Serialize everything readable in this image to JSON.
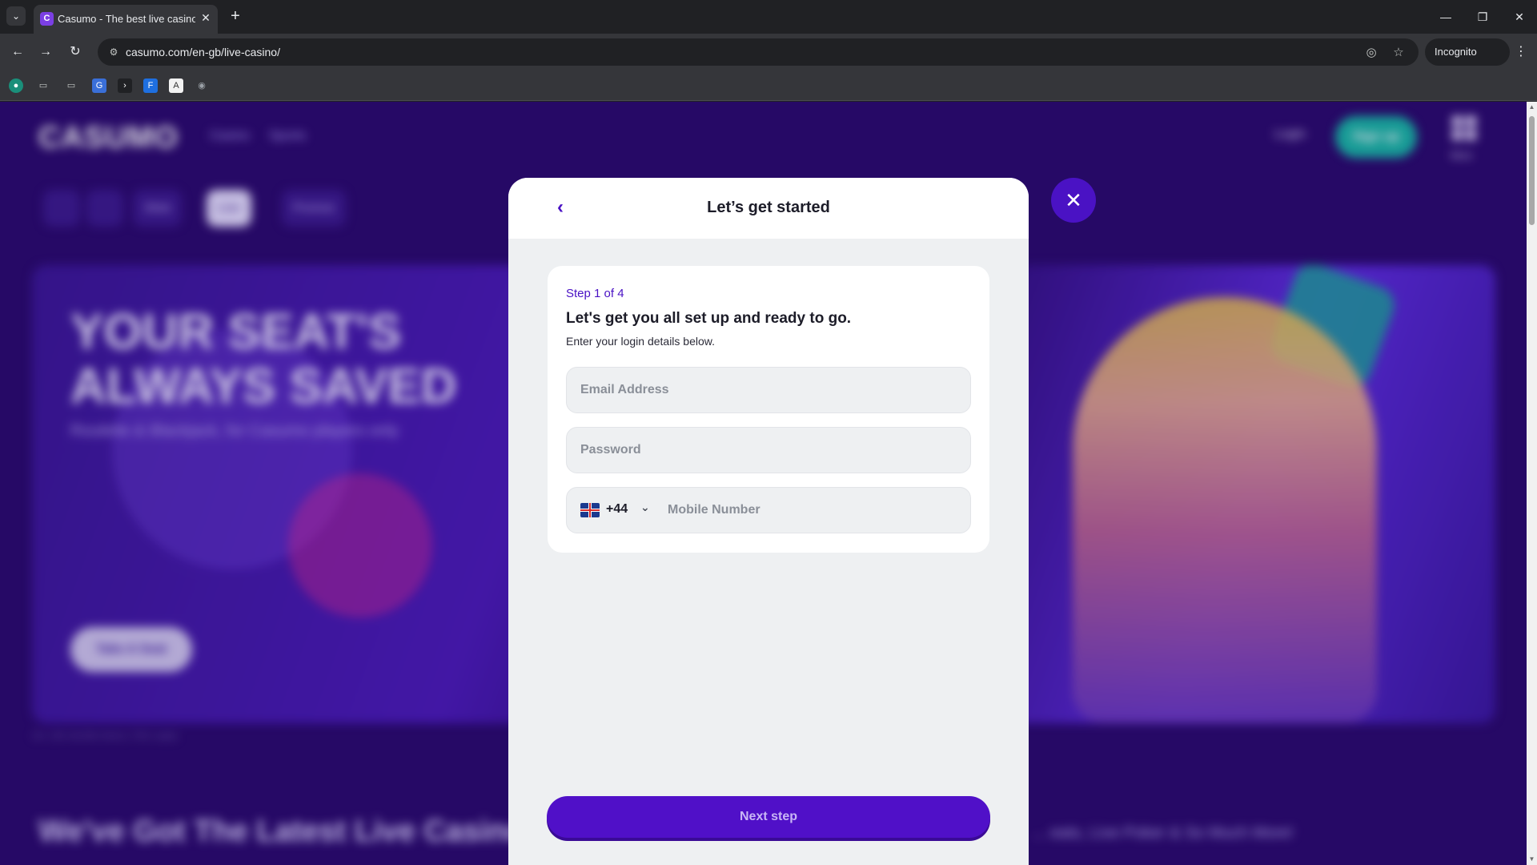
{
  "browser": {
    "tab": {
      "title": "Casumo - The best live casino in",
      "favicon_letter": "C"
    },
    "url": "casumo.com/en-gb/live-casino/",
    "incognito_label": "Incognito",
    "icons": {
      "back": "←",
      "forward": "→",
      "reload": "↻",
      "site_info": "⚙",
      "eye_off": "◎",
      "star": "☆",
      "menu": "⋮",
      "tab_list": "⌄",
      "new_tab": "+",
      "tab_close": "✕",
      "minimize": "—",
      "restore": "❐",
      "close": "✕"
    },
    "bookmarks": [
      "●",
      "▭",
      "▭",
      "G",
      "›",
      "F",
      "A",
      "◉"
    ]
  },
  "page": {
    "logo": "CASUMO",
    "nav": [
      "Casino",
      "Sports"
    ],
    "login": "Login",
    "signup": "Sign up",
    "more": "More",
    "categories": [
      "",
      "",
      "Slots",
      "Live",
      "Promos"
    ],
    "hero_title": "YOUR SEAT'S ALWAYS SAVED",
    "hero_subtitle": "Roulette & Blackjack, for Casumo players only",
    "hero_cta": "Take A Seat",
    "hero_note": "18+ | Be Gamble Aware | T&Cs apply",
    "section_title": "We've Got The Latest Live Casino",
    "section_subtitle": "... eats, Live Poker & So Much More!"
  },
  "modal": {
    "title": "Let’s get started",
    "back_icon": "‹",
    "close_icon": "✕",
    "step_label": "Step 1 of 4",
    "heading": "Let's get you all set up and ready to go.",
    "subheading": "Enter your login details below.",
    "email_placeholder": "Email Address",
    "password_placeholder": "Password",
    "country_code": "+44",
    "country_chevron": "⌄",
    "mobile_placeholder": "Mobile Number",
    "next_button": "Next step"
  },
  "colors": {
    "accent": "#5010c8",
    "page_bg": "#2a0a6e",
    "modal_bg": "#eef0f2"
  }
}
